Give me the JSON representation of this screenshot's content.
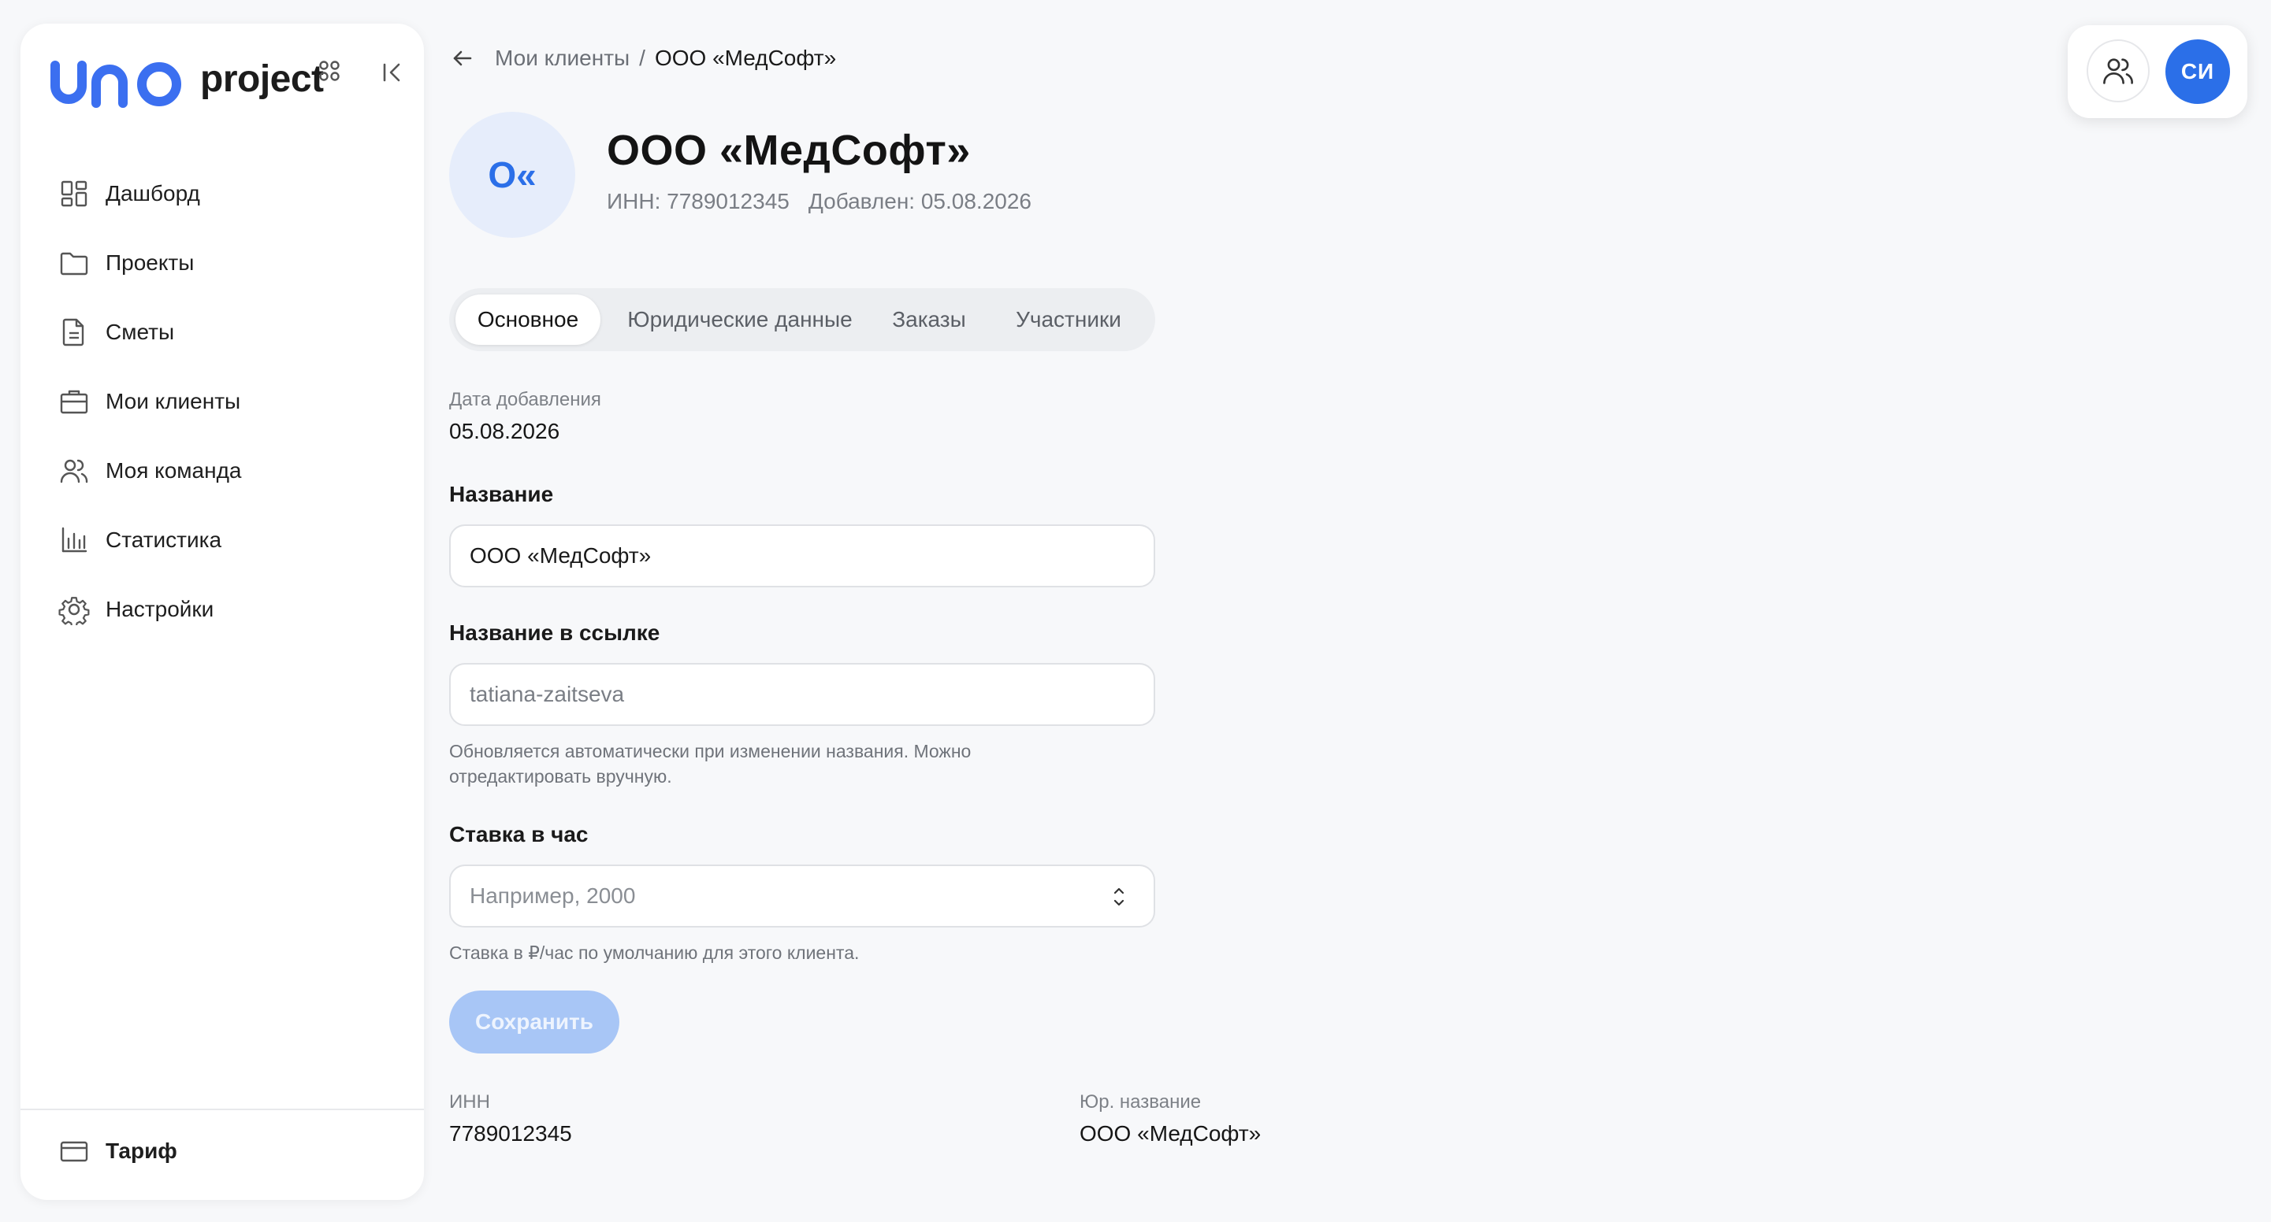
{
  "brand": {
    "logo_text": "uno",
    "name": "project"
  },
  "sidebar": {
    "items": [
      {
        "label": "Дашборд",
        "icon": "dashboard-icon"
      },
      {
        "label": "Проекты",
        "icon": "folder-icon"
      },
      {
        "label": "Сметы",
        "icon": "document-icon"
      },
      {
        "label": "Мои клиенты",
        "icon": "briefcase-icon"
      },
      {
        "label": "Моя команда",
        "icon": "users-icon"
      },
      {
        "label": "Статистика",
        "icon": "bar-chart-icon"
      },
      {
        "label": "Настройки",
        "icon": "gear-icon"
      }
    ],
    "footer": {
      "label": "Тариф",
      "icon": "credit-card-icon"
    }
  },
  "header": {
    "user_initials": "СИ"
  },
  "breadcrumb": {
    "parent": "Мои клиенты",
    "separator": "/",
    "current": "ООО «МедСофт»"
  },
  "client": {
    "avatar_text": "О«",
    "name": "ООО «МедСофт»",
    "inn_meta": "ИНН: 7789012345",
    "added_meta": "Добавлен: 05.08.2026"
  },
  "tabs": [
    {
      "label": "Основное",
      "active": true
    },
    {
      "label": "Юридические данные",
      "active": false
    },
    {
      "label": "Заказы",
      "active": false
    },
    {
      "label": "Участники",
      "active": false
    }
  ],
  "form": {
    "date_caption": "Дата добавления",
    "date_value": "05.08.2026",
    "name_label": "Название",
    "name_value": "ООО «МедСофт»",
    "slug_label": "Название в ссылке",
    "slug_value": "tatiana-zaitseva",
    "slug_hint": "Обновляется автоматически при изменении названия. Можно отредактировать вручную.",
    "rate_label": "Ставка в час",
    "rate_placeholder": "Например, 2000",
    "rate_hint": "Ставка в ₽/час по умолчанию для этого клиента.",
    "save_label": "Сохранить"
  },
  "legal": {
    "inn_caption": "ИНН",
    "inn_value": "7789012345",
    "legal_name_caption": "Юр. название",
    "legal_name_value": "ООО «МедСофт»"
  },
  "colors": {
    "accent": "#2b6fe8",
    "avatar_bg": "#e6edfb",
    "save_disabled": "#a8c6f6",
    "page_bg": "#f7f8fa"
  }
}
